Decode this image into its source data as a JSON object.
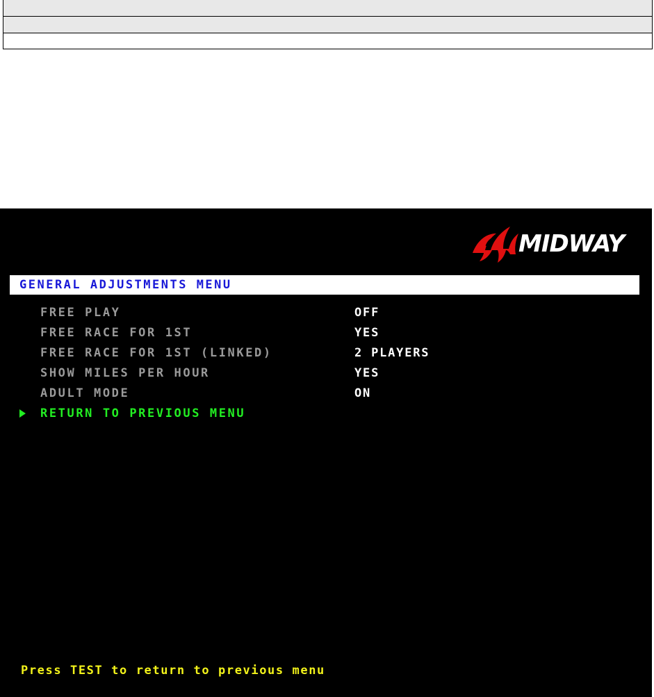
{
  "logo": {
    "text": "MIDWAY",
    "mark_color": "#e01010"
  },
  "menu": {
    "title": "GENERAL ADJUSTMENTS MENU",
    "items": [
      {
        "label": "FREE PLAY",
        "value": "OFF"
      },
      {
        "label": "FREE RACE FOR 1ST",
        "value": "YES"
      },
      {
        "label": "FREE RACE FOR 1ST (LINKED)",
        "value": "2 PLAYERS"
      },
      {
        "label": "SHOW MILES PER HOUR",
        "value": "YES"
      },
      {
        "label": "ADULT MODE",
        "value": "ON"
      },
      {
        "label": "RETURN TO PREVIOUS MENU",
        "value": ""
      }
    ],
    "selected_index": 5
  },
  "footer": {
    "hint": "Press TEST to return to previous menu"
  },
  "colors": {
    "title": "#1818d8",
    "item_normal": "#9a9a9a",
    "item_selected": "#22ee22",
    "value": "#ffffff",
    "footer": "#f2f21a"
  }
}
